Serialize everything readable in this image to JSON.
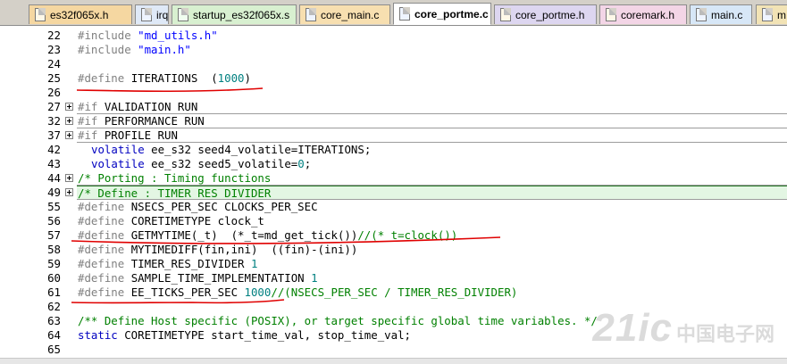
{
  "tabs": [
    {
      "label": "es32f065x.h",
      "kind": "h",
      "active": false
    },
    {
      "label": "irq.c",
      "kind": "c",
      "active": false
    },
    {
      "label": "startup_es32f065x.s",
      "kind": "s",
      "active": false
    },
    {
      "label": "core_main.c",
      "kind": "c",
      "active": false
    },
    {
      "label": "core_portme.c",
      "kind": "c",
      "active": true
    },
    {
      "label": "core_portme.h",
      "kind": "h",
      "active": false
    },
    {
      "label": "coremark.h",
      "kind": "h",
      "active": false
    },
    {
      "label": "main.c",
      "kind": "c",
      "active": false
    },
    {
      "label": "m",
      "kind": "c",
      "active": false
    }
  ],
  "lines": [
    {
      "n": "22",
      "fold": false,
      "segs": [
        [
          "pre",
          "#include "
        ],
        [
          "str",
          "\"md_utils.h\""
        ]
      ]
    },
    {
      "n": "23",
      "fold": false,
      "segs": [
        [
          "pre",
          "#include "
        ],
        [
          "str",
          "\"main.h\""
        ]
      ]
    },
    {
      "n": "24",
      "fold": false,
      "segs": []
    },
    {
      "n": "25",
      "fold": false,
      "segs": [
        [
          "pre",
          "#define "
        ],
        [
          "txt",
          "ITERATIONS  ("
        ],
        [
          "num",
          "1000"
        ],
        [
          "txt",
          ")"
        ]
      ]
    },
    {
      "n": "26",
      "fold": false,
      "segs": []
    },
    {
      "n": "27",
      "fold": true,
      "segs": [
        [
          "pre",
          "#if "
        ],
        [
          "txt",
          "VALIDATION RUN"
        ]
      ]
    },
    {
      "n": "32",
      "fold": true,
      "segs": [
        [
          "pre",
          "#if "
        ],
        [
          "txt",
          "PERFORMANCE RUN"
        ]
      ]
    },
    {
      "n": "37",
      "fold": true,
      "segs": [
        [
          "pre",
          "#if "
        ],
        [
          "txt",
          "PROFILE RUN"
        ]
      ]
    },
    {
      "n": "42",
      "fold": false,
      "indent": true,
      "segs": [
        [
          "kw",
          "volatile "
        ],
        [
          "txt",
          "ee_s32 seed4_volatile=ITERATIONS;"
        ]
      ]
    },
    {
      "n": "43",
      "fold": false,
      "indent": true,
      "segs": [
        [
          "kw",
          "volatile "
        ],
        [
          "txt",
          "ee_s32 seed5_volatile="
        ],
        [
          "num",
          "0"
        ],
        [
          "txt",
          ";"
        ]
      ]
    },
    {
      "n": "44",
      "fold": true,
      "segs": [
        [
          "cmt",
          "/* Porting : Timing functions"
        ]
      ]
    },
    {
      "n": "49",
      "fold": true,
      "highlight": true,
      "segs": [
        [
          "cmt",
          "/* Define : TIMER RES DIVIDER"
        ]
      ]
    },
    {
      "n": "55",
      "fold": false,
      "segs": [
        [
          "pre",
          "#define "
        ],
        [
          "txt",
          "NSECS_PER_SEC CLOCKS_PER_SEC"
        ]
      ]
    },
    {
      "n": "56",
      "fold": false,
      "segs": [
        [
          "pre",
          "#define "
        ],
        [
          "txt",
          "CORETIMETYPE clock_t"
        ]
      ]
    },
    {
      "n": "57",
      "fold": false,
      "segs": [
        [
          "pre",
          "#define "
        ],
        [
          "txt",
          "GETMYTIME(_t)  (*_t=md_get_tick())"
        ],
        [
          "cmt",
          "//(*_t=clock())"
        ]
      ]
    },
    {
      "n": "58",
      "fold": false,
      "segs": [
        [
          "pre",
          "#define "
        ],
        [
          "txt",
          "MYTIMEDIFF(fin,ini)  ((fin)-(ini))"
        ]
      ]
    },
    {
      "n": "59",
      "fold": false,
      "segs": [
        [
          "pre",
          "#define "
        ],
        [
          "txt",
          "TIMER_RES_DIVIDER "
        ],
        [
          "num",
          "1"
        ]
      ]
    },
    {
      "n": "60",
      "fold": false,
      "segs": [
        [
          "pre",
          "#define "
        ],
        [
          "txt",
          "SAMPLE_TIME_IMPLEMENTATION "
        ],
        [
          "num",
          "1"
        ]
      ]
    },
    {
      "n": "61",
      "fold": false,
      "segs": [
        [
          "pre",
          "#define "
        ],
        [
          "txt",
          "EE_TICKS_PER_SEC "
        ],
        [
          "num",
          "1000"
        ],
        [
          "cmt",
          "//(NSECS_PER_SEC / TIMER_RES_DIVIDER)"
        ]
      ]
    },
    {
      "n": "62",
      "fold": false,
      "segs": []
    },
    {
      "n": "63",
      "fold": false,
      "segs": [
        [
          "cmt",
          "/** Define Host specific (POSIX), or target specific global time variables. */"
        ]
      ]
    },
    {
      "n": "64",
      "fold": false,
      "segs": [
        [
          "kw",
          "static "
        ],
        [
          "txt",
          "CORETIMETYPE start_time_val, stop_time_val;"
        ]
      ]
    },
    {
      "n": "65",
      "fold": false,
      "segs": []
    }
  ],
  "watermark": {
    "latin": "21ic",
    "cn": "中国电子网"
  },
  "colors": {
    "annotation": "#e00000",
    "highlight_bg": "#e3f6e3",
    "preprocessor": "#808080",
    "keyword": "#0000c0",
    "number": "#008080",
    "comment": "#008000"
  }
}
